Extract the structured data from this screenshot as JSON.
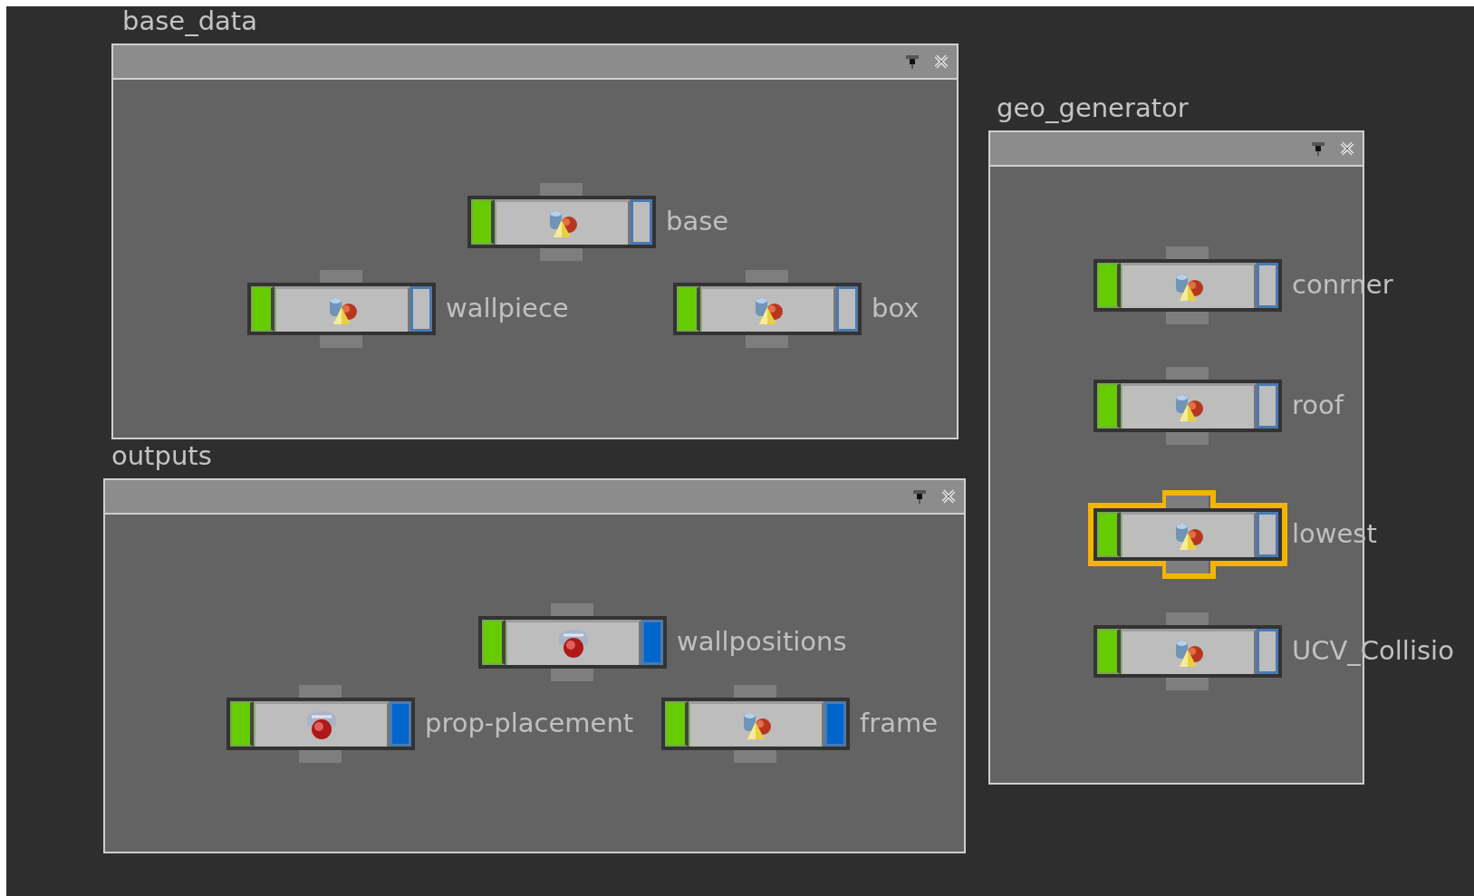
{
  "network_boxes": [
    {
      "title": "base_data",
      "nodes": [
        {
          "name": "base",
          "kind": "shapes",
          "display": false,
          "selected": false
        },
        {
          "name": "wallpiece",
          "kind": "shapes",
          "display": false,
          "selected": false
        },
        {
          "name": "box",
          "kind": "shapes",
          "display": false,
          "selected": false
        }
      ]
    },
    {
      "title": "outputs",
      "nodes": [
        {
          "name": "wallpositions",
          "kind": "ball",
          "display": true,
          "selected": false
        },
        {
          "name": "prop-placement",
          "kind": "ball",
          "display": true,
          "selected": false
        },
        {
          "name": "frame",
          "kind": "shapes",
          "display": true,
          "selected": false
        }
      ]
    },
    {
      "title": "geo_generator",
      "nodes": [
        {
          "name": "conrner",
          "kind": "shapes",
          "display": false,
          "selected": false
        },
        {
          "name": "roof",
          "kind": "shapes",
          "display": false,
          "selected": false
        },
        {
          "name": "lowest",
          "kind": "shapes",
          "display": false,
          "selected": true
        },
        {
          "name": "UCV_Collisio",
          "kind": "shapes",
          "display": false,
          "selected": false
        }
      ]
    }
  ]
}
